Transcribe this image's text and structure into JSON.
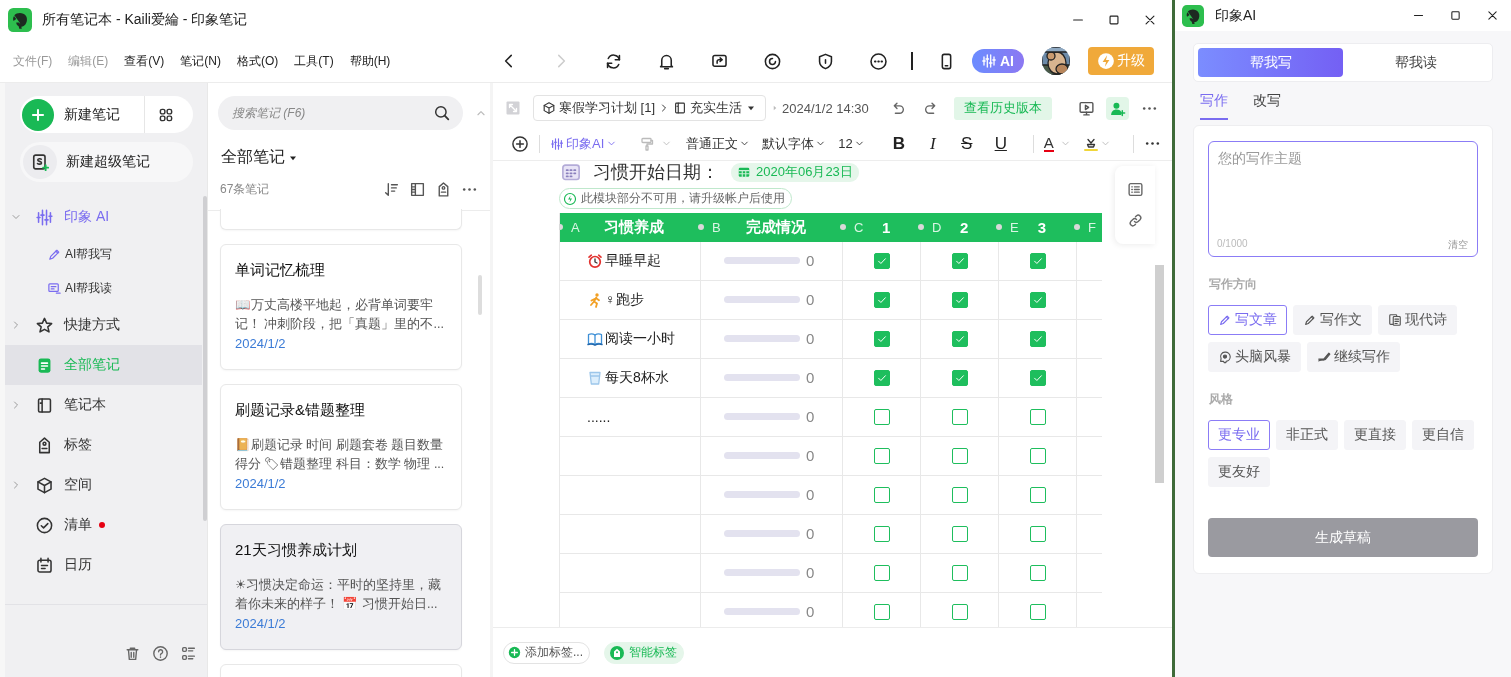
{
  "window": {
    "title": "所有笔记本 - Kaili爱綸 - 印象笔记"
  },
  "menu": [
    {
      "label": "文件(F)",
      "disabled": true
    },
    {
      "label": "编辑(E)",
      "disabled": true
    },
    {
      "label": "查看(V)",
      "disabled": false
    },
    {
      "label": "笔记(N)",
      "disabled": false
    },
    {
      "label": "格式(O)",
      "disabled": false
    },
    {
      "label": "工具(T)",
      "disabled": false
    },
    {
      "label": "帮助(H)",
      "disabled": false
    }
  ],
  "nav": [
    {
      "disabled": false
    },
    {
      "disabled": true
    }
  ],
  "toolbar": {
    "ai_label": "AI",
    "upgrade_label": "升级"
  },
  "sidebar": {
    "new_note": "新建笔记",
    "new_super_note": "新建超级笔记",
    "items": [
      {
        "kind": "ai",
        "label": "印象 AI",
        "expanded": true,
        "selected": false,
        "unread": false,
        "children": [
          {
            "kind": "ai-write",
            "label": "AI帮我写",
            "selected": false,
            "unread": false
          },
          {
            "kind": "ai-read",
            "label": "AI帮我读",
            "selected": false,
            "unread": false
          }
        ]
      },
      {
        "kind": "star",
        "label": "快捷方式",
        "expanded": false,
        "selected": false,
        "unread": false
      },
      {
        "kind": "notes",
        "label": "全部笔记",
        "selected": true,
        "unread": false
      },
      {
        "kind": "notebook",
        "label": "笔记本",
        "expanded": false,
        "selected": false,
        "unread": false
      },
      {
        "kind": "tag",
        "label": "标签",
        "selected": false,
        "unread": false
      },
      {
        "kind": "space",
        "label": "空间",
        "expanded": false,
        "selected": false,
        "unread": false
      },
      {
        "kind": "checklist",
        "label": "清单",
        "selected": false,
        "unread": true
      },
      {
        "kind": "calendar",
        "label": "日历",
        "selected": false,
        "unread": false
      }
    ]
  },
  "note_list": {
    "search": {
      "placeholder": "搜索笔记 (F6)"
    },
    "title": "全部笔记",
    "count": "67条笔记",
    "notes": [
      {
        "title": "单词记忆梳理",
        "preview": "📖万丈高楼平地起，必背单词要牢记！ 冲刺阶段，把「真题」里的不...",
        "date": "2024/1/2",
        "selected": false
      },
      {
        "title": "刷题记录&错题整理",
        "preview": "📔刷题记录 时间 刷题套卷 题目数量得分 🏷错题整理 科目：数学 物理 ...",
        "date": "2024/1/2",
        "selected": false
      },
      {
        "title": "21天习惯养成计划",
        "preview": "☀习惯决定命运：平时的坚持里，藏着你未来的样子！ 📅 习惯开始日...",
        "date": "2024/1/2",
        "selected": true
      }
    ]
  },
  "editor": {
    "breadcrumb": {
      "stack": "寒假学习计划 [1]",
      "notebook": "充实生活"
    },
    "updated": "2024/1/2 14:30",
    "history_button": "查看历史版本",
    "format": {
      "ai": "印象AI",
      "paragraph": "普通正文",
      "font": "默认字体",
      "size": "12",
      "bold": "B",
      "italic": "I",
      "strike": "S",
      "underline": "U",
      "text_color_label": "A"
    },
    "note": {
      "date_label": "习惯开始日期：",
      "date": "2020年06月23日",
      "notice": "此模块部分不可用，请升级帐户后使用",
      "table": {
        "columns": [
          {
            "letter": "A",
            "title": "习惯养成"
          },
          {
            "letter": "B",
            "title": "完成情况"
          },
          {
            "letter": "C",
            "title": "1"
          },
          {
            "letter": "D",
            "title": "2"
          },
          {
            "letter": "E",
            "title": "3"
          },
          {
            "letter": "F"
          }
        ],
        "rows": [
          {
            "kind": "alarm",
            "habit": "早睡早起",
            "level": 0,
            "reading": "0",
            "checks": [
              true,
              true,
              true
            ]
          },
          {
            "kind": "runner",
            "habit": "♀跑步",
            "level": 0,
            "reading": "0",
            "checks": [
              true,
              true,
              true
            ]
          },
          {
            "kind": "book",
            "habit": "阅读一小时",
            "level": 0,
            "reading": "0",
            "checks": [
              true,
              true,
              true
            ]
          },
          {
            "kind": "glass",
            "habit": "每天8杯水",
            "level": 0,
            "reading": "0",
            "checks": [
              true,
              true,
              true
            ]
          },
          {
            "habit": "......",
            "level": 0,
            "reading": "0",
            "checks": [
              false,
              false,
              false
            ]
          },
          {
            "level": 0,
            "reading": "0",
            "checks": [
              false,
              false,
              false
            ]
          },
          {
            "level": 0,
            "reading": "0",
            "checks": [
              false,
              false,
              false
            ]
          },
          {
            "level": 0,
            "reading": "0",
            "checks": [
              false,
              false,
              false
            ]
          },
          {
            "level": 0,
            "reading": "0",
            "checks": [
              false,
              false,
              false
            ]
          },
          {
            "level": 0,
            "reading": "0",
            "checks": [
              false,
              false,
              false
            ]
          }
        ]
      }
    },
    "tags": {
      "add": "添加标签...",
      "smart": "智能标签"
    }
  },
  "ai_panel": {
    "title": "印象AI",
    "modes": [
      {
        "label": "帮我写",
        "selected": true
      },
      {
        "label": "帮我读",
        "selected": false
      }
    ],
    "tabs": [
      {
        "label": "写作",
        "selected": true
      },
      {
        "label": "改写",
        "selected": false
      }
    ],
    "topic": {
      "placeholder": "您的写作主题",
      "count": "0/1000",
      "clear": "清空"
    },
    "direction": {
      "title": "写作方向",
      "options": [
        {
          "kind": "pen",
          "label": "写文章",
          "selected": true
        },
        {
          "kind": "pen",
          "label": "写作文",
          "selected": false
        },
        {
          "kind": "doc",
          "label": "现代诗",
          "selected": false
        },
        {
          "kind": "brain",
          "label": "头脑风暴",
          "selected": false
        },
        {
          "kind": "writing",
          "label": "继续写作",
          "selected": false
        }
      ]
    },
    "style": {
      "title": "风格",
      "options": [
        {
          "label": "更专业",
          "selected": true
        },
        {
          "label": "非正式",
          "selected": false
        },
        {
          "label": "更直接",
          "selected": false
        },
        {
          "label": "更自信",
          "selected": false
        },
        {
          "label": "更友好",
          "selected": false
        }
      ]
    },
    "generate": {
      "label": "生成草稿",
      "disabled": true
    }
  }
}
